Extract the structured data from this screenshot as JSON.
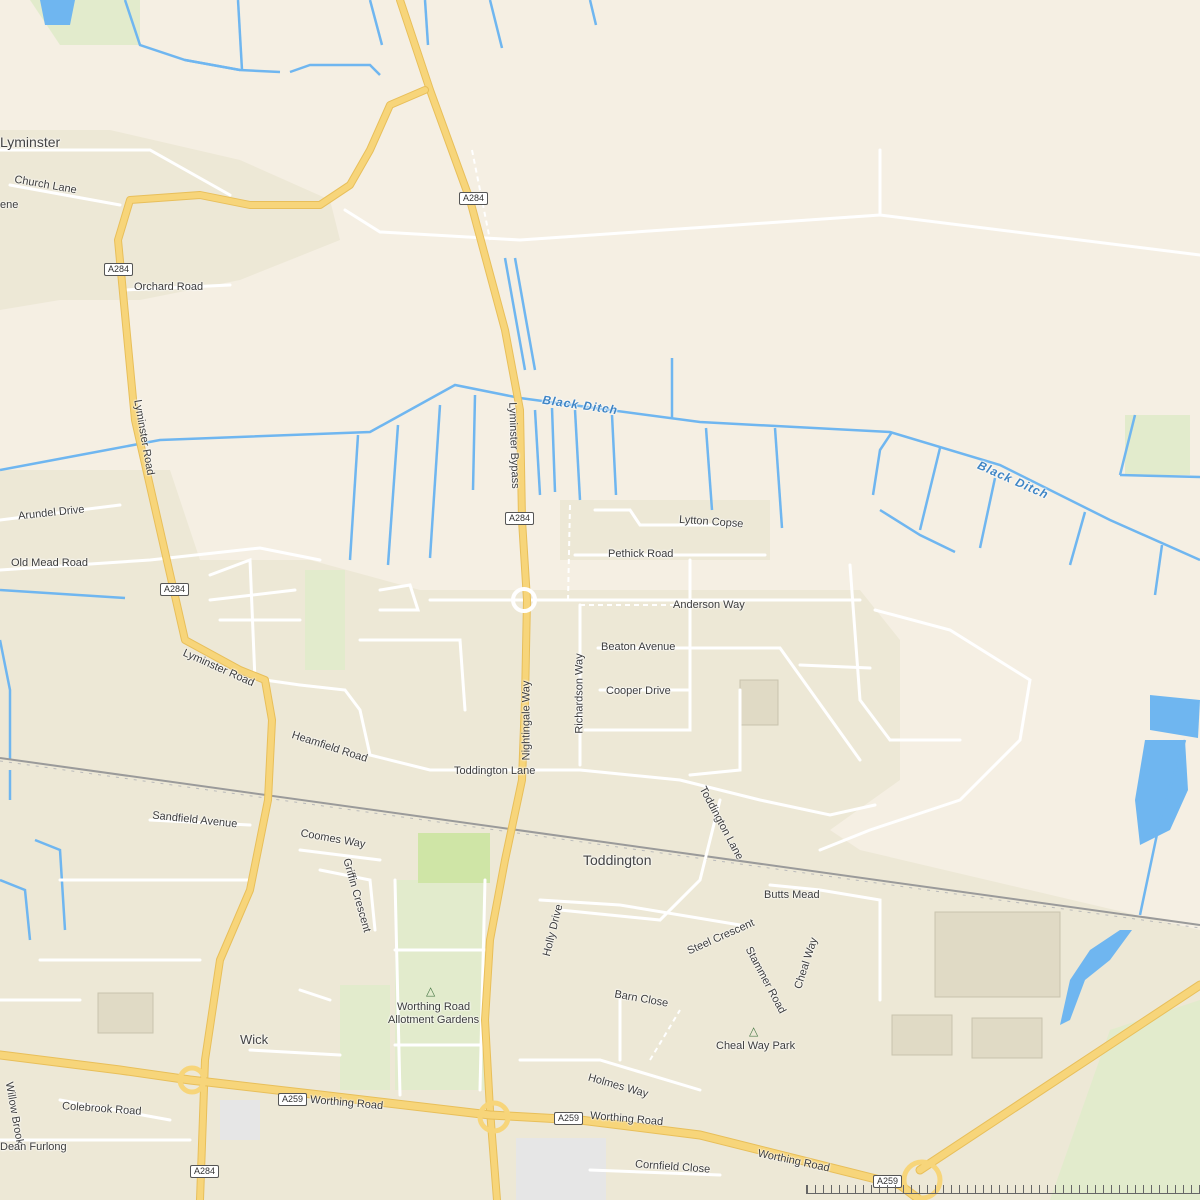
{
  "places": {
    "lyminster": "Lyminster",
    "toddington": "Toddington",
    "wick": "Wick"
  },
  "water": {
    "black_ditch_1": "Black Ditch",
    "black_ditch_2": "Black Ditch"
  },
  "streets": {
    "church_lane": "Church Lane",
    "partial_lane": "ene",
    "orchard_road": "Orchard Road",
    "arundel_drive": "Arundel Drive",
    "old_mead_road": "Old Mead Road",
    "lyminster_road_1": "Lyminster Road",
    "lyminster_road_2": "Lyminster Road",
    "lyminster_bypass": "Lyminster Bypass",
    "lytton_copse": "Lytton Copse",
    "pethick_road": "Pethick Road",
    "anderson_way": "Anderson Way",
    "beaton_avenue": "Beaton Avenue",
    "cooper_drive": "Cooper Drive",
    "richardson_way": "Richardson Way",
    "nightingale_way": "Nightingale Way",
    "heamfield_road": "Heamfield Road",
    "toddington_lane_1": "Toddington Lane",
    "toddington_lane_2": "Toddington Lane",
    "sandfield_avenue": "Sandfield Avenue",
    "coomes_way": "Coomes Way",
    "griffin_crescent": "Griffin Crescent",
    "butts_mead": "Butts Mead",
    "steel_crescent": "Steel Crescent",
    "stammer_road": "Stammer Road",
    "cheal_way": "Cheal Way",
    "holly_drive": "Holly Drive",
    "barn_close": "Barn Close",
    "holmes_way": "Holmes Way",
    "worthing_road_1": "Worthing Road",
    "worthing_road_2": "Worthing Road",
    "worthing_road_3": "Worthing Road",
    "willow_brook": "Willow Brook",
    "colebrook_road": "Colebrook Road",
    "dean_furlong": "Dean Furlong",
    "cornfield_close": "Cornfield Close"
  },
  "pois": {
    "allotments": "Worthing Road\nAllotment Gardens",
    "cheal_way_park": "Cheal Way Park"
  },
  "shields": {
    "a284_1": "A284",
    "a284_2": "A284",
    "a284_3": "A284",
    "a284_4": "A284",
    "a284_5": "A284",
    "a259_1": "A259",
    "a259_2": "A259",
    "a259_3": "A259"
  },
  "colors": {
    "land": "#f5efe3",
    "urban": "#ede8d6",
    "green": "#e2ebcc",
    "water": "#6fb6f0",
    "road_major": "#f7d57a",
    "road_major_casing": "#e8bf5a",
    "road_minor": "#ffffff",
    "rail": "#9a9a9a"
  }
}
